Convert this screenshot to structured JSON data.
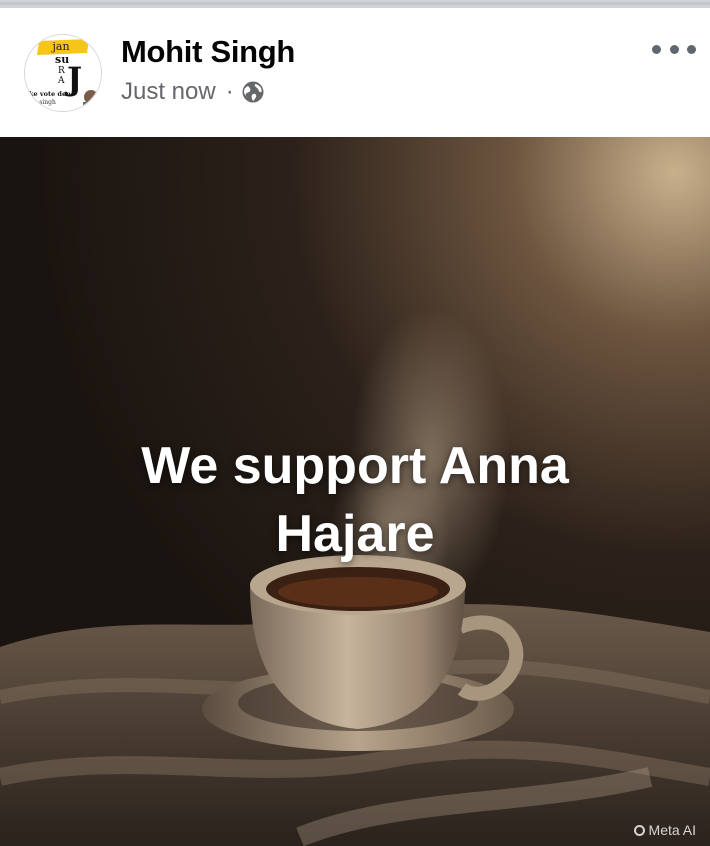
{
  "post": {
    "author": "Mohit Singh",
    "time": "Just now",
    "separator": "·",
    "audience_icon": "globe-icon",
    "more_icon": "more-options-icon",
    "avatar_texts": [
      "jan",
      "su",
      "R",
      "A",
      "J",
      "ke vote den",
      "it singh"
    ]
  },
  "image": {
    "caption": "We support Anna Hajare",
    "watermark": "Meta AI"
  },
  "colors": {
    "author": "#050505",
    "meta": "#65676b",
    "caption": "#ffffff"
  }
}
